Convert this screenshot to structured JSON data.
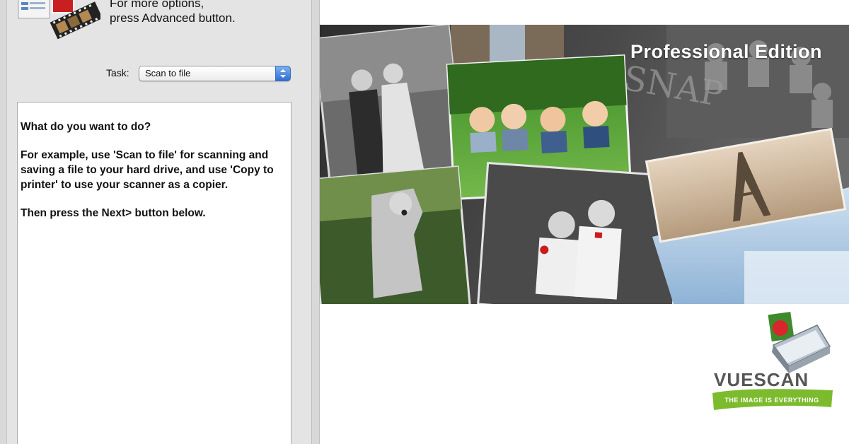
{
  "hint": {
    "text": "For more options,\npress Advanced button."
  },
  "task": {
    "label": "Task:",
    "selected": "Scan to file"
  },
  "instructions": {
    "question": "What do you want to do?",
    "example": "For example, use 'Scan to file' for scanning and saving a file to your hard drive, and use 'Copy to printer' to use your scanner as a copier.",
    "next": "Then press the Next> button below."
  },
  "banner": {
    "edition": "Professional Edition",
    "snap_text": "SNAP"
  },
  "logo": {
    "word": "VUESCAN",
    "tagline": "THE IMAGE IS EVERYTHING"
  },
  "colors": {
    "accent_blue": "#2f6fd3",
    "panel_gray": "#e4e4e4",
    "logo_green": "#7dbb2e"
  },
  "icons": {
    "app": "scanner-film-icon",
    "stepper": "select-stepper-icon",
    "logo": "vuescan-scanner-icon"
  }
}
